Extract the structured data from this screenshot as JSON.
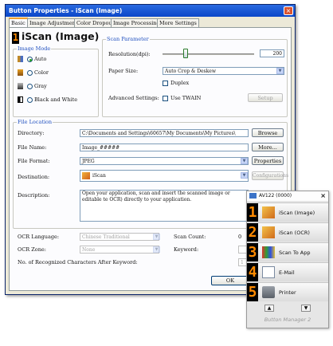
{
  "window": {
    "title": "Button Properties - iScan (Image)",
    "tabs": [
      "Basic",
      "Image Adjustment",
      "Color Dropout",
      "Image Processing",
      "More Settings"
    ],
    "header_title": "iScan (Image)",
    "header_digit": "1"
  },
  "image_mode": {
    "legend": "Image Mode",
    "options": [
      "Auto",
      "Color",
      "Gray",
      "Black and White"
    ],
    "selected": "Auto"
  },
  "scan_parameter": {
    "legend": "Scan Parameter",
    "resolution_label": "Resolution(dpi):",
    "resolution_value": "200",
    "resolution_level": 0.25,
    "paper_size_label": "Paper Size:",
    "paper_size_value": "Auto Crop & Deskew",
    "duplex_label": "Duplex",
    "advanced_label": "Advanced Settings:",
    "twain_label": "Use TWAIN",
    "setup_button": "Setup"
  },
  "file_location": {
    "legend": "File Location",
    "directory_label": "Directory:",
    "directory_value": "C:\\Documents and Settings\\60657\\My Documents\\My Pictures\\",
    "browse_button": "Browse",
    "file_name_label": "File Name:",
    "file_name_value": "Image_#####",
    "more_button": "More...",
    "file_format_label": "File Format:",
    "file_format_value": "JPEG",
    "properties_button": "Properties",
    "destination_label": "Destination:",
    "destination_value": "iScan",
    "configurations_button": "Configurations",
    "description_label": "Description:",
    "description_value": "Open your application, scan and insert the scanned image or editable te OCR) directly to your application."
  },
  "ocr": {
    "language_label": "OCR Language:",
    "language_value": "Chinese Traditional",
    "zone_label": "OCR Zone:",
    "zone_value": "None",
    "scan_count_label": "Scan Count:",
    "scan_count_value": "0",
    "keyword_label": "Keyword:",
    "recognized_label": "No. of Recognized Characters After Keyword:",
    "recognized_value": "1"
  },
  "ok_button": "OK",
  "button_manager": {
    "title": "AV122 (0000)",
    "close_glyph": "×",
    "items": [
      {
        "digit": "1",
        "label": "iScan (Image)"
      },
      {
        "digit": "2",
        "label": "iScan (OCR)"
      },
      {
        "digit": "3",
        "label": "Scan To App"
      },
      {
        "digit": "4",
        "label": "E-Mail"
      },
      {
        "digit": "5",
        "label": "Printer"
      }
    ],
    "footer": "Button Manager 2",
    "colors": {
      "digit": "#ff8a00",
      "digit_bg": "#000000"
    }
  },
  "colors": {
    "title_bar": "#0a46c8",
    "dialog_bg": "#ece9d8",
    "legend": "#1f4fbf"
  }
}
